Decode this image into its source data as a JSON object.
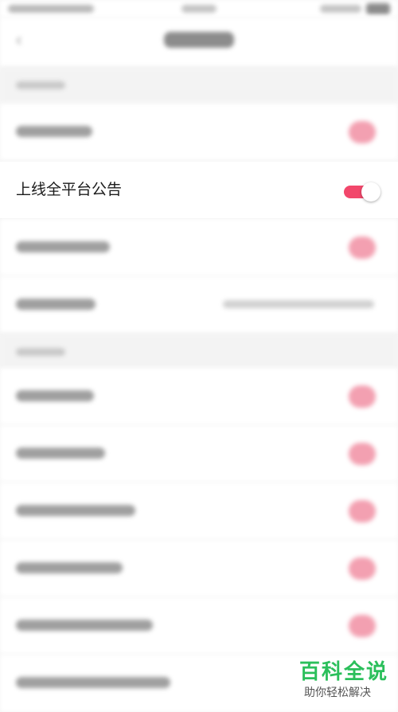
{
  "clear_row": {
    "label": "上线全平台公告",
    "toggle_on": true,
    "toggle_color": "#f2476b"
  },
  "blurred_rows": [
    {
      "control": "toggle"
    },
    {
      "control": "toggle"
    },
    {
      "control": "select"
    },
    {
      "control": "toggle"
    },
    {
      "control": "toggle"
    },
    {
      "control": "toggle"
    },
    {
      "control": "toggle"
    },
    {
      "control": "toggle"
    },
    {
      "control": "none"
    }
  ],
  "watermark": {
    "title": "百科全说",
    "subtitle": "助你轻松解决"
  },
  "colors": {
    "accent": "#f2476b",
    "background": "#f6f6f6",
    "watermark_green": "#2bbf5b"
  }
}
